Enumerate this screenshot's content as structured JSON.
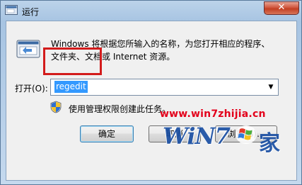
{
  "window": {
    "title": "运行",
    "close_label": "✕"
  },
  "dialog": {
    "description_line1": "Windows 将根据您所输入的名称，为您打开相应的程序、",
    "description_line2": "文件夹、文档或 Internet 资源。",
    "open_label": "打开(O):",
    "open_value": "regedit",
    "admin_note": "使用管理权限创建此任务。"
  },
  "buttons": {
    "ok": "确定",
    "cancel": "取消",
    "browse": "浏览(B)..."
  },
  "watermark": {
    "url": "www.win7zhijia.cn",
    "logo_text": "WiN7",
    "logo_char": "家"
  },
  "colors": {
    "selection": "#3399ff",
    "highlight_box": "#d31b1b",
    "watermark_red": "#e3001b",
    "logo_blue": "#1a4fa3"
  },
  "icons": {
    "app": "run-dialog-icon",
    "run": "run-program-icon",
    "shield": "uac-shield-icon",
    "dropdown": "chevron-down-icon"
  }
}
